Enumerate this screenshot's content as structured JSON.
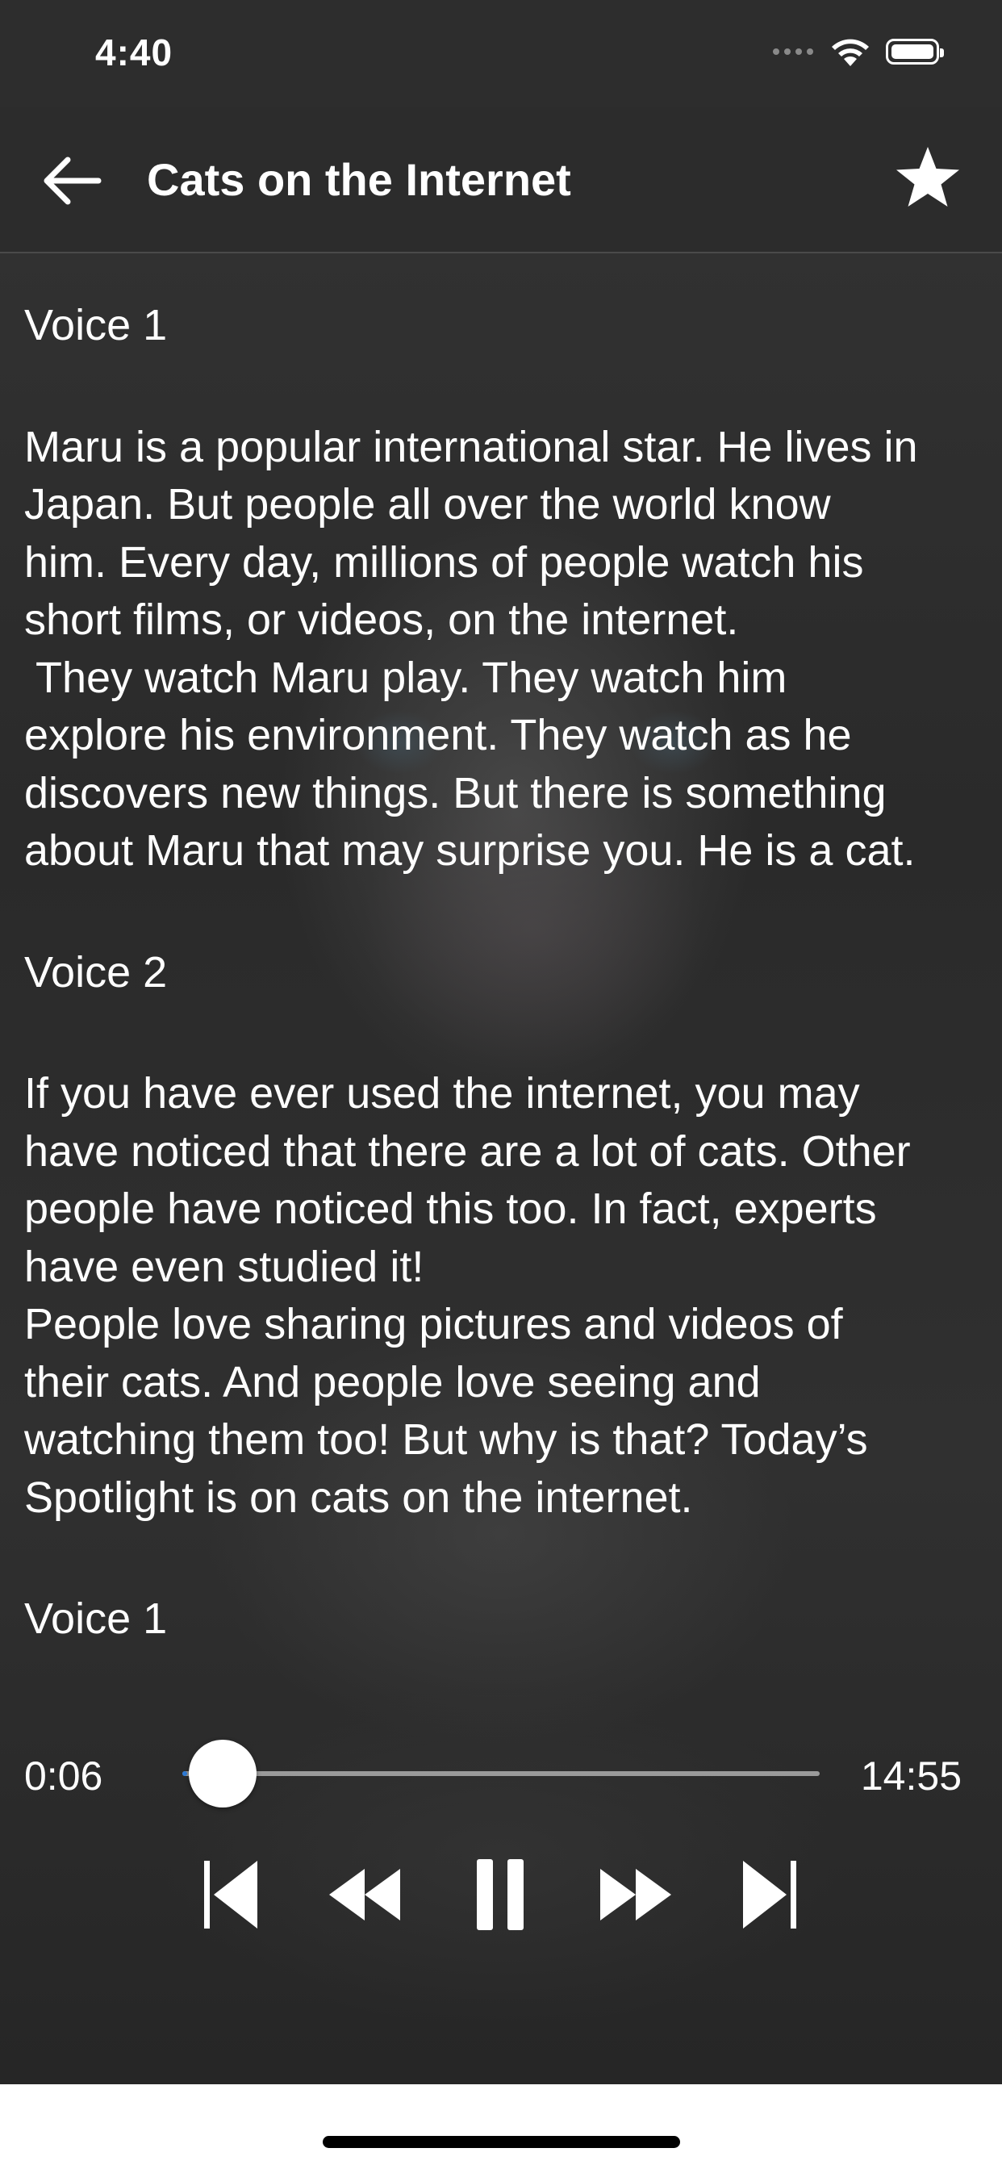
{
  "status_bar": {
    "time": "4:40",
    "signal_icon": "cellular-signal-icon",
    "wifi_icon": "wifi-icon",
    "battery_icon": "battery-icon"
  },
  "header": {
    "back_icon": "back-arrow-icon",
    "title": "Cats on the Internet",
    "favorite_icon": "star-icon"
  },
  "transcript": {
    "sections": [
      {
        "speaker": "Voice 1",
        "lines": [
          "Maru is a popular international star. He lives in",
          "Japan. But people all over the world know",
          "him. Every day, millions of people watch his",
          "short films, or videos, on the internet.",
          " They watch Maru play. They watch him",
          "explore his environment. They watch as he",
          "discovers new things. But there is something",
          "about Maru that may surprise you. He is a cat."
        ]
      },
      {
        "speaker": "Voice 2",
        "lines": [
          "If you have ever used the internet, you may",
          "have noticed that there are a lot of cats. Other",
          "people have noticed this too. In fact, experts",
          "have even studied it!",
          "People love sharing pictures and videos of",
          "their cats. And people love seeing and",
          "watching them too! But why is that? Today’s",
          "Spotlight is on cats on the internet."
        ]
      },
      {
        "speaker": "Voice 1",
        "lines": []
      }
    ]
  },
  "player": {
    "elapsed": "0:06",
    "total": "14:55",
    "progress": 0.007,
    "controls": {
      "previous_icon": "skip-previous-icon",
      "rewind_icon": "rewind-icon",
      "pause_icon": "pause-icon",
      "forward_icon": "fast-forward-icon",
      "next_icon": "skip-next-icon"
    }
  },
  "colors": {
    "accent": "#2e7bd6",
    "background": "#2b2b2b",
    "text": "#ffffff"
  }
}
